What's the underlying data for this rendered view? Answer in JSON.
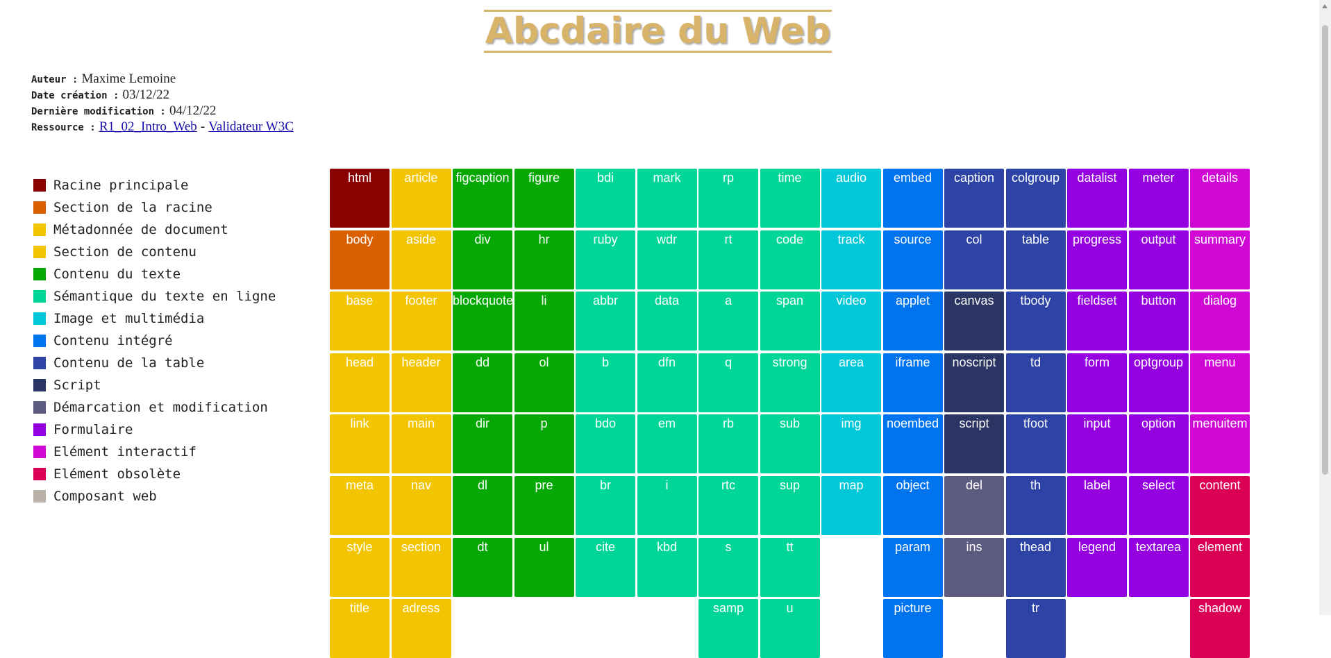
{
  "title": "Abcdaire du Web",
  "meta": {
    "author_label": "Auteur :",
    "author": "Maxime Lemoine",
    "created_label": "Date création :",
    "created": "03/12/22",
    "modified_label": "Dernière modification :",
    "modified": "04/12/22",
    "resource_label": "Ressource :",
    "resource_link1": "R1_02_Intro_Web",
    "resource_sep": "-",
    "resource_link2": "Validateur W3C"
  },
  "colors": {
    "racine": "#8b0000",
    "section_racine": "#d95f00",
    "metadonnee": "#f2c500",
    "section_contenu": "#f2c500",
    "contenu_texte": "#06a806",
    "semantique": "#00d698",
    "multimedia": "#00c8d8",
    "integre": "#0073ee",
    "table": "#2d44a6",
    "script": "#2a3564",
    "demarcation": "#5d5a7f",
    "formulaire": "#9500e0",
    "interactif": "#cf08d6",
    "obsolete": "#db0056",
    "composant": "#bab2a8"
  },
  "legend": [
    {
      "label": "Racine principale",
      "color": "#8b0000"
    },
    {
      "label": "Section de la racine",
      "color": "#d95f00"
    },
    {
      "label": "Métadonnée de document",
      "color": "#f2c500"
    },
    {
      "label": "Section de contenu",
      "color": "#f2c500"
    },
    {
      "label": "Contenu du texte",
      "color": "#06a806"
    },
    {
      "label": "Sémantique du texte en ligne",
      "color": "#00d698"
    },
    {
      "label": "Image et multimédia",
      "color": "#00c8d8"
    },
    {
      "label": "Contenu intégré",
      "color": "#0073ee"
    },
    {
      "label": "Contenu de la table",
      "color": "#2d44a6"
    },
    {
      "label": "Script",
      "color": "#2a3564"
    },
    {
      "label": "Démarcation et modification",
      "color": "#5d5a7f"
    },
    {
      "label": "Formulaire",
      "color": "#9500e0"
    },
    {
      "label": "Elément interactif",
      "color": "#cf08d6"
    },
    {
      "label": "Elément obsolète",
      "color": "#db0056"
    },
    {
      "label": "Composant web",
      "color": "#bab2a8"
    }
  ],
  "columns": [
    {
      "cells": [
        {
          "tag": "html",
          "cat": "racine"
        },
        {
          "tag": "body",
          "cat": "section_racine"
        },
        {
          "tag": "base",
          "cat": "metadonnee"
        },
        {
          "tag": "head",
          "cat": "metadonnee"
        },
        {
          "tag": "link",
          "cat": "metadonnee"
        },
        {
          "tag": "meta",
          "cat": "metadonnee"
        },
        {
          "tag": "style",
          "cat": "metadonnee"
        },
        {
          "tag": "title",
          "cat": "metadonnee"
        }
      ]
    },
    {
      "cells": [
        {
          "tag": "article",
          "cat": "section_contenu"
        },
        {
          "tag": "aside",
          "cat": "section_contenu"
        },
        {
          "tag": "footer",
          "cat": "section_contenu"
        },
        {
          "tag": "header",
          "cat": "section_contenu"
        },
        {
          "tag": "main",
          "cat": "section_contenu"
        },
        {
          "tag": "nav",
          "cat": "section_contenu"
        },
        {
          "tag": "section",
          "cat": "section_contenu"
        },
        {
          "tag": "adress",
          "cat": "section_contenu"
        }
      ]
    },
    {
      "cells": [
        {
          "tag": "figcaption",
          "cat": "contenu_texte"
        },
        {
          "tag": "div",
          "cat": "contenu_texte"
        },
        {
          "tag": "blockquote",
          "cat": "contenu_texte"
        },
        {
          "tag": "dd",
          "cat": "contenu_texte"
        },
        {
          "tag": "dir",
          "cat": "contenu_texte"
        },
        {
          "tag": "dl",
          "cat": "contenu_texte"
        },
        {
          "tag": "dt",
          "cat": "contenu_texte"
        },
        {
          "tag": "",
          "cat": ""
        }
      ]
    },
    {
      "cells": [
        {
          "tag": "figure",
          "cat": "contenu_texte"
        },
        {
          "tag": "hr",
          "cat": "contenu_texte"
        },
        {
          "tag": "li",
          "cat": "contenu_texte"
        },
        {
          "tag": "ol",
          "cat": "contenu_texte"
        },
        {
          "tag": "p",
          "cat": "contenu_texte"
        },
        {
          "tag": "pre",
          "cat": "contenu_texte"
        },
        {
          "tag": "ul",
          "cat": "contenu_texte"
        },
        {
          "tag": "",
          "cat": ""
        }
      ]
    },
    {
      "cells": [
        {
          "tag": "bdi",
          "cat": "semantique"
        },
        {
          "tag": "ruby",
          "cat": "semantique"
        },
        {
          "tag": "abbr",
          "cat": "semantique"
        },
        {
          "tag": "b",
          "cat": "semantique"
        },
        {
          "tag": "bdo",
          "cat": "semantique"
        },
        {
          "tag": "br",
          "cat": "semantique"
        },
        {
          "tag": "cite",
          "cat": "semantique"
        },
        {
          "tag": "",
          "cat": ""
        }
      ]
    },
    {
      "cells": [
        {
          "tag": "mark",
          "cat": "semantique"
        },
        {
          "tag": "wdr",
          "cat": "semantique"
        },
        {
          "tag": "data",
          "cat": "semantique"
        },
        {
          "tag": "dfn",
          "cat": "semantique"
        },
        {
          "tag": "em",
          "cat": "semantique"
        },
        {
          "tag": "i",
          "cat": "semantique"
        },
        {
          "tag": "kbd",
          "cat": "semantique"
        },
        {
          "tag": "",
          "cat": ""
        }
      ]
    },
    {
      "cells": [
        {
          "tag": "rp",
          "cat": "semantique"
        },
        {
          "tag": "rt",
          "cat": "semantique"
        },
        {
          "tag": "a",
          "cat": "semantique"
        },
        {
          "tag": "q",
          "cat": "semantique"
        },
        {
          "tag": "rb",
          "cat": "semantique"
        },
        {
          "tag": "rtc",
          "cat": "semantique"
        },
        {
          "tag": "s",
          "cat": "semantique"
        },
        {
          "tag": "samp",
          "cat": "semantique"
        }
      ]
    },
    {
      "cells": [
        {
          "tag": "time",
          "cat": "semantique"
        },
        {
          "tag": "code",
          "cat": "semantique"
        },
        {
          "tag": "span",
          "cat": "semantique"
        },
        {
          "tag": "strong",
          "cat": "semantique"
        },
        {
          "tag": "sub",
          "cat": "semantique"
        },
        {
          "tag": "sup",
          "cat": "semantique"
        },
        {
          "tag": "tt",
          "cat": "semantique"
        },
        {
          "tag": "u",
          "cat": "semantique"
        }
      ]
    },
    {
      "cells": [
        {
          "tag": "audio",
          "cat": "multimedia"
        },
        {
          "tag": "track",
          "cat": "multimedia"
        },
        {
          "tag": "video",
          "cat": "multimedia"
        },
        {
          "tag": "area",
          "cat": "multimedia"
        },
        {
          "tag": "img",
          "cat": "multimedia"
        },
        {
          "tag": "map",
          "cat": "multimedia"
        },
        {
          "tag": "",
          "cat": ""
        },
        {
          "tag": "",
          "cat": ""
        }
      ]
    },
    {
      "cells": [
        {
          "tag": "embed",
          "cat": "integre"
        },
        {
          "tag": "source",
          "cat": "integre"
        },
        {
          "tag": "applet",
          "cat": "integre"
        },
        {
          "tag": "iframe",
          "cat": "integre"
        },
        {
          "tag": "noembed",
          "cat": "integre"
        },
        {
          "tag": "object",
          "cat": "integre"
        },
        {
          "tag": "param",
          "cat": "integre"
        },
        {
          "tag": "picture",
          "cat": "integre"
        }
      ]
    },
    {
      "cells": [
        {
          "tag": "caption",
          "cat": "table"
        },
        {
          "tag": "col",
          "cat": "table"
        },
        {
          "tag": "canvas",
          "cat": "script"
        },
        {
          "tag": "noscript",
          "cat": "script"
        },
        {
          "tag": "script",
          "cat": "script"
        },
        {
          "tag": "del",
          "cat": "demarcation"
        },
        {
          "tag": "ins",
          "cat": "demarcation"
        },
        {
          "tag": "",
          "cat": ""
        }
      ]
    },
    {
      "cells": [
        {
          "tag": "colgroup",
          "cat": "table"
        },
        {
          "tag": "table",
          "cat": "table"
        },
        {
          "tag": "tbody",
          "cat": "table"
        },
        {
          "tag": "td",
          "cat": "table"
        },
        {
          "tag": "tfoot",
          "cat": "table"
        },
        {
          "tag": "th",
          "cat": "table"
        },
        {
          "tag": "thead",
          "cat": "table"
        },
        {
          "tag": "tr",
          "cat": "table"
        }
      ]
    },
    {
      "cells": [
        {
          "tag": "datalist",
          "cat": "formulaire"
        },
        {
          "tag": "progress",
          "cat": "formulaire"
        },
        {
          "tag": "fieldset",
          "cat": "formulaire"
        },
        {
          "tag": "form",
          "cat": "formulaire"
        },
        {
          "tag": "input",
          "cat": "formulaire"
        },
        {
          "tag": "label",
          "cat": "formulaire"
        },
        {
          "tag": "legend",
          "cat": "formulaire"
        },
        {
          "tag": "",
          "cat": ""
        }
      ]
    },
    {
      "cells": [
        {
          "tag": "meter",
          "cat": "formulaire"
        },
        {
          "tag": "output",
          "cat": "formulaire"
        },
        {
          "tag": "button",
          "cat": "formulaire"
        },
        {
          "tag": "optgroup",
          "cat": "formulaire"
        },
        {
          "tag": "option",
          "cat": "formulaire"
        },
        {
          "tag": "select",
          "cat": "formulaire"
        },
        {
          "tag": "textarea",
          "cat": "formulaire"
        },
        {
          "tag": "",
          "cat": ""
        }
      ]
    },
    {
      "cells": [
        {
          "tag": "details",
          "cat": "interactif"
        },
        {
          "tag": "summary",
          "cat": "interactif"
        },
        {
          "tag": "dialog",
          "cat": "interactif"
        },
        {
          "tag": "menu",
          "cat": "interactif"
        },
        {
          "tag": "menuitem",
          "cat": "interactif"
        },
        {
          "tag": "content",
          "cat": "obsolete"
        },
        {
          "tag": "element",
          "cat": "obsolete"
        },
        {
          "tag": "shadow",
          "cat": "obsolete"
        }
      ]
    }
  ]
}
